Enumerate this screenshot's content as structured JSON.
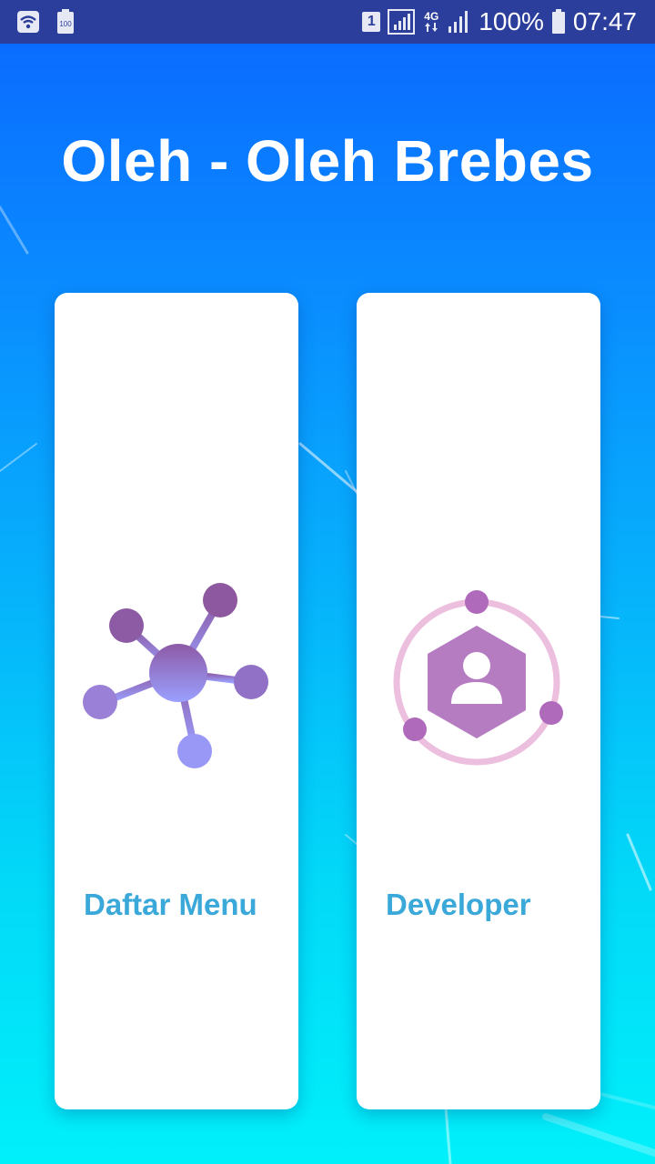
{
  "status_bar": {
    "battery_small_label": "100",
    "sim_slot": "1",
    "network_type": "4G",
    "battery_percent": "100%",
    "time": "07:47"
  },
  "app": {
    "title": "Oleh - Oleh Brebes"
  },
  "cards": [
    {
      "label": "Daftar Menu",
      "icon": "network-nodes-icon"
    },
    {
      "label": "Developer",
      "icon": "developer-profile-icon"
    }
  ],
  "colors": {
    "status_bar": "#2c3e9c",
    "gradient_top": "#0a6cff",
    "gradient_bottom": "#00f0fa",
    "card_label": "#3aa8d8",
    "icon_purple": "#9a6bc4"
  }
}
